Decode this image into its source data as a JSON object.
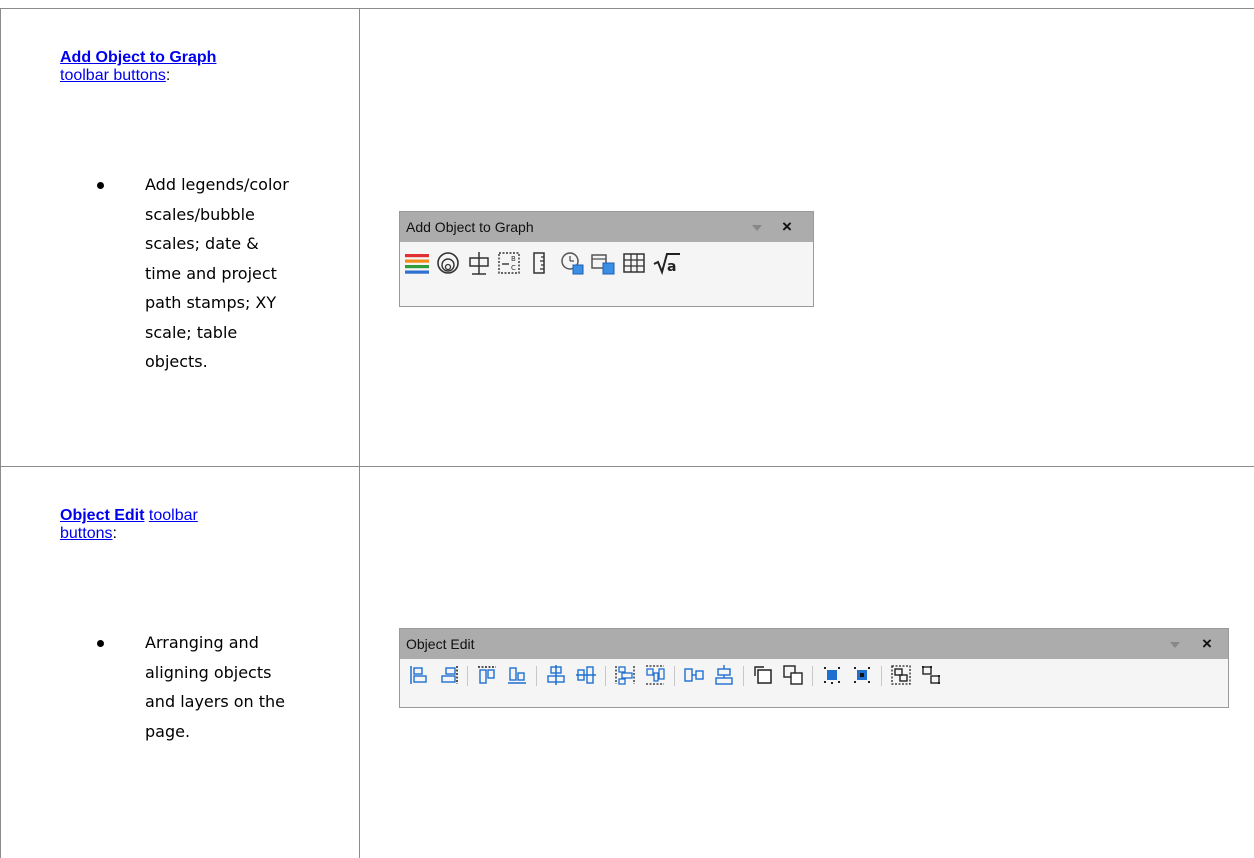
{
  "rows": [
    {
      "heading_link": "Add Object to Graph",
      "sub_link": "toolbar buttons",
      "punct": ":",
      "bullet_lines": [
        "Add legends/color",
        "scales/bubble",
        "scales; date &",
        "time and project",
        "path stamps; XY",
        "scale; table",
        "objects."
      ],
      "toolbar": {
        "title": "Add Object to Graph",
        "close_label": "×",
        "buttons": [
          "legend-icon",
          "color-scale-icon",
          "bubble-scale-icon",
          "scale-bar-icon",
          "xy-scale-icon",
          "date-time-stamp-icon",
          "project-path-stamp-icon",
          "table-icon",
          "equation-icon"
        ]
      }
    },
    {
      "heading_link": "Object Edit",
      "sub_link_a": "toolbar",
      "sub_link_b": "buttons",
      "punct": ":",
      "bullet_lines": [
        "Arranging and",
        "aligning objects",
        "and layers on the",
        "page."
      ],
      "toolbar": {
        "title": "Object Edit",
        "close_label": "×",
        "buttons": [
          "align-left-icon",
          "align-right-icon",
          "align-top-icon",
          "align-bottom-icon",
          "align-vertical-center-icon",
          "align-horizontal-center-icon",
          "distribute-vertical-icon",
          "distribute-horizontal-icon",
          "same-width-icon",
          "same-height-icon",
          "bring-to-front-icon",
          "send-to-back-icon",
          "bring-forward-icon",
          "send-backward-icon",
          "group-icon",
          "ungroup-icon"
        ]
      }
    }
  ]
}
